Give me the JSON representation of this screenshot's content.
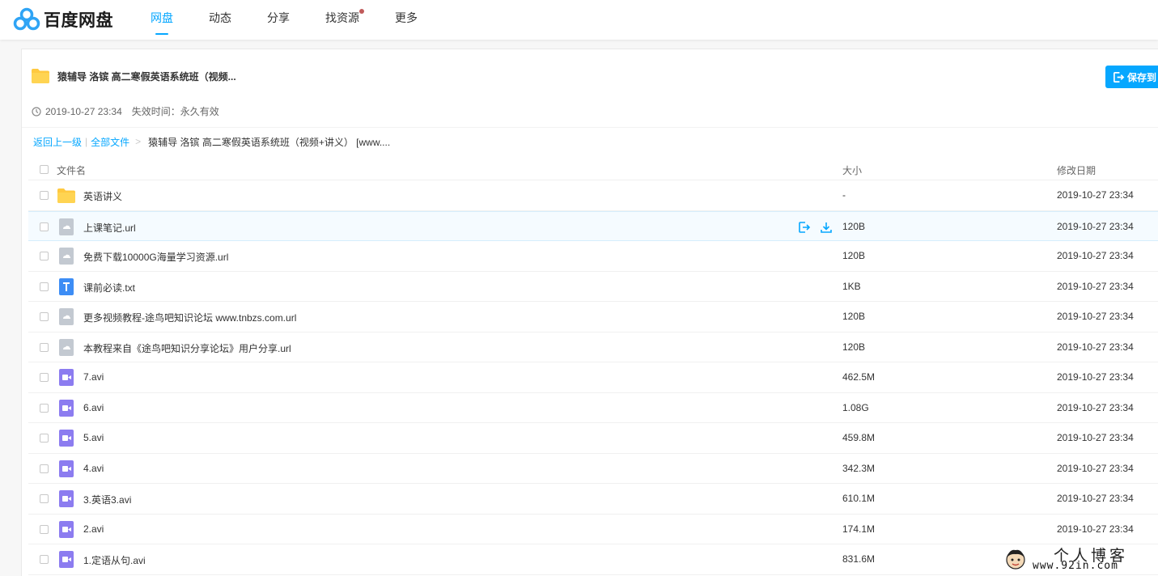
{
  "brand": {
    "name": "百度网盘"
  },
  "nav": [
    {
      "label": "网盘",
      "active": true
    },
    {
      "label": "动态",
      "active": false
    },
    {
      "label": "分享",
      "active": false
    },
    {
      "label": "找资源",
      "active": false,
      "dot": true
    },
    {
      "label": "更多",
      "active": false
    }
  ],
  "share": {
    "title": "猿辅导 洛镔 高二寒假英语系统班（视频...",
    "created": "2019-10-27 23:34",
    "expiry": "失效时间：永久有效",
    "save_label": "保存到"
  },
  "breadcrumb": {
    "back": "返回上一级",
    "sep": "|",
    "all": "全部文件",
    "arrow": ">",
    "current": "猿辅导 洛镔 高二寒假英语系统班（视频+讲义） [www...."
  },
  "table": {
    "headers": {
      "name": "文件名",
      "size": "大小",
      "date": "修改日期"
    },
    "rows": [
      {
        "name": "英语讲义",
        "size": "-",
        "date": "2019-10-27 23:34",
        "type": "folder-icon"
      },
      {
        "name": "上课笔记.url",
        "size": "120B",
        "date": "2019-10-27 23:34",
        "type": "url-file-icon"
      },
      {
        "name": "免费下载10000G海量学习资源.url",
        "size": "120B",
        "date": "2019-10-27 23:34",
        "type": "url-file-icon"
      },
      {
        "name": "课前必读.txt",
        "size": "1KB",
        "date": "2019-10-27 23:34",
        "type": "text-file-icon"
      },
      {
        "name": "更多视频教程-途鸟吧知识论坛 www.tnbzs.com.url",
        "size": "120B",
        "date": "2019-10-27 23:34",
        "type": "url-file-icon"
      },
      {
        "name": "本教程来自《途鸟吧知识分享论坛》用户分享.url",
        "size": "120B",
        "date": "2019-10-27 23:34",
        "type": "url-file-icon"
      },
      {
        "name": "7.avi",
        "size": "462.5M",
        "date": "2019-10-27 23:34",
        "type": "video-file-icon"
      },
      {
        "name": "6.avi",
        "size": "1.08G",
        "date": "2019-10-27 23:34",
        "type": "video-file-icon"
      },
      {
        "name": "5.avi",
        "size": "459.8M",
        "date": "2019-10-27 23:34",
        "type": "video-file-icon"
      },
      {
        "name": "4.avi",
        "size": "342.3M",
        "date": "2019-10-27 23:34",
        "type": "video-file-icon"
      },
      {
        "name": "3.英语3.avi",
        "size": "610.1M",
        "date": "2019-10-27 23:34",
        "type": "video-file-icon"
      },
      {
        "name": "2.avi",
        "size": "174.1M",
        "date": "2019-10-27 23:34",
        "type": "video-file-icon"
      },
      {
        "name": "1.定语从句.avi",
        "size": "831.6M",
        "date": "",
        "type": "video-file-icon"
      }
    ]
  },
  "watermark": {
    "title": "个人博客",
    "url": "www.92in.com"
  },
  "colors": {
    "accent": "#06a7ff",
    "folder": "#ffc940",
    "video": "#8c7cf0",
    "text_file": "#3d8df5",
    "url_file": "#c3c9d1"
  }
}
